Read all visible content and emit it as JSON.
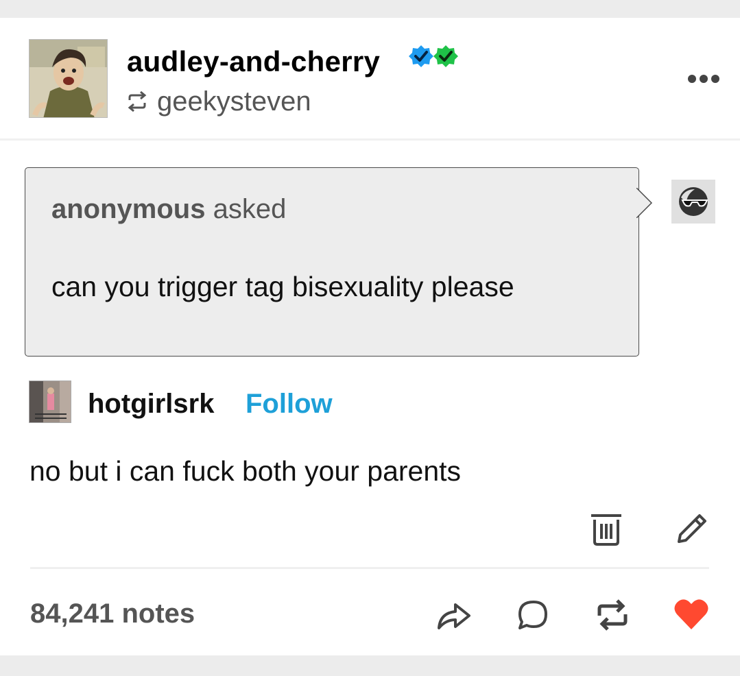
{
  "post": {
    "username": "audley-and-cherry",
    "reblogged_from": "geekysteven",
    "ask": {
      "asker": "anonymous",
      "asked_label": "asked",
      "question": "can you trigger tag bisexuality please"
    },
    "answer": {
      "author": "hotgirlsrk",
      "follow_label": "Follow",
      "text": "no but i can fuck both your parents"
    },
    "notes": "84,241 notes"
  },
  "colors": {
    "follow_link": "#1ea0d8",
    "like_heart": "#ff4930",
    "badge_blue": "#1e9bf0",
    "badge_green": "#1fc248"
  },
  "icons": [
    "retweet-icon",
    "more-icon",
    "verified-badge-blue",
    "verified-badge-green",
    "sunglasses-icon",
    "trash-icon",
    "pencil-icon",
    "share-icon",
    "reply-icon",
    "reblog-icon",
    "heart-icon"
  ]
}
